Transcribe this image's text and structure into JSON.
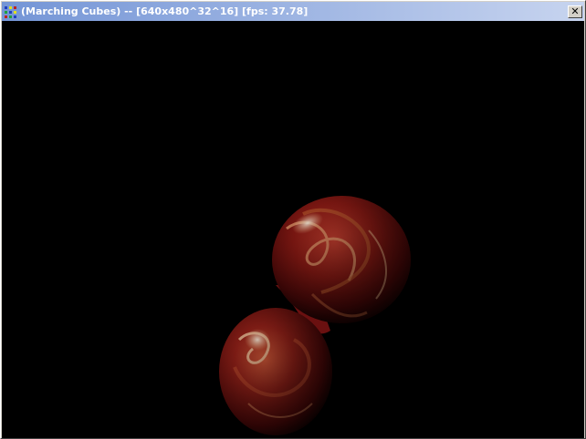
{
  "window": {
    "title": "(Marching Cubes) -- [640x480^32^16] [fps: 37.78]",
    "close_glyph": "✕",
    "titlebar_gradient": [
      "#7495d6",
      "#c7d4ef"
    ],
    "icon": "app-icon"
  },
  "scene": {
    "background": "#000000",
    "object": "metaball-blob",
    "base_color": "#5a0a0a",
    "highlight_color": "#f0d0b0"
  }
}
